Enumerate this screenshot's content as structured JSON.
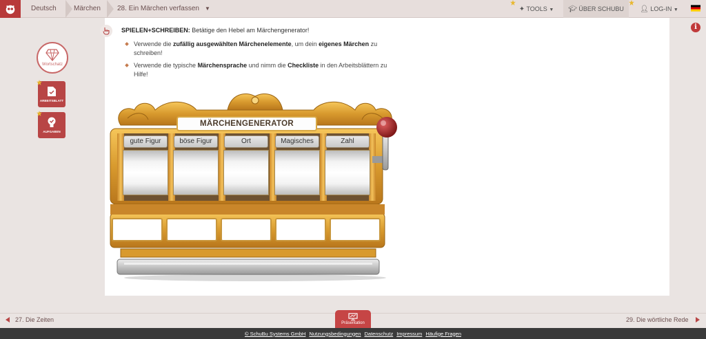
{
  "breadcrumb": [
    "Deutsch",
    "Märchen",
    "28. Ein Märchen verfassen"
  ],
  "topbar": {
    "tools": "TOOLS",
    "about": "ÜBER SCHUBU",
    "login": "LOG-IN"
  },
  "sidebar": {
    "vocab_label": "Wortschatz",
    "worksheet_label": "ARBEITSBLATT",
    "tasks_label": "AUFGABEN"
  },
  "task": {
    "label": "SPIELEN+SCHREIBEN:",
    "text": "Betätige den Hebel am Märchengenerator!",
    "bullets": [
      {
        "p1": "Verwende die ",
        "b1": "zufällig ausgewählten Märchenelemente",
        "p2": ", um dein ",
        "b2": "eigenes Märchen",
        "p3": " zu schreiben!"
      },
      {
        "p1": "Verwende die typische ",
        "b1": "Märchensprache",
        "p2": " und nimm die ",
        "b2": "Checkliste",
        "p3": " in den Arbeitsblättern zu Hilfe!"
      }
    ]
  },
  "machine": {
    "title": "MÄRCHENGENERATOR",
    "reels": [
      "gute Figur",
      "böse Figur",
      "Ort",
      "Magisches",
      "Zahl"
    ]
  },
  "nav": {
    "prev": "27. Die Zeiten",
    "next": "29. Die wörtliche Rede",
    "presentation": "Präsentation"
  },
  "footer": [
    "© SchuBu Systems GmbH",
    "Nutzungsbedingungen",
    "Datenschutz",
    "Impressum",
    "Häufige Fragen"
  ],
  "colors": {
    "brand": "#b84545",
    "gold": "#d89a2e",
    "bar": "#e7dedc"
  },
  "icons": {
    "logo": "owl-logo-icon",
    "info": "info-icon",
    "flag": "german-flag-icon"
  }
}
